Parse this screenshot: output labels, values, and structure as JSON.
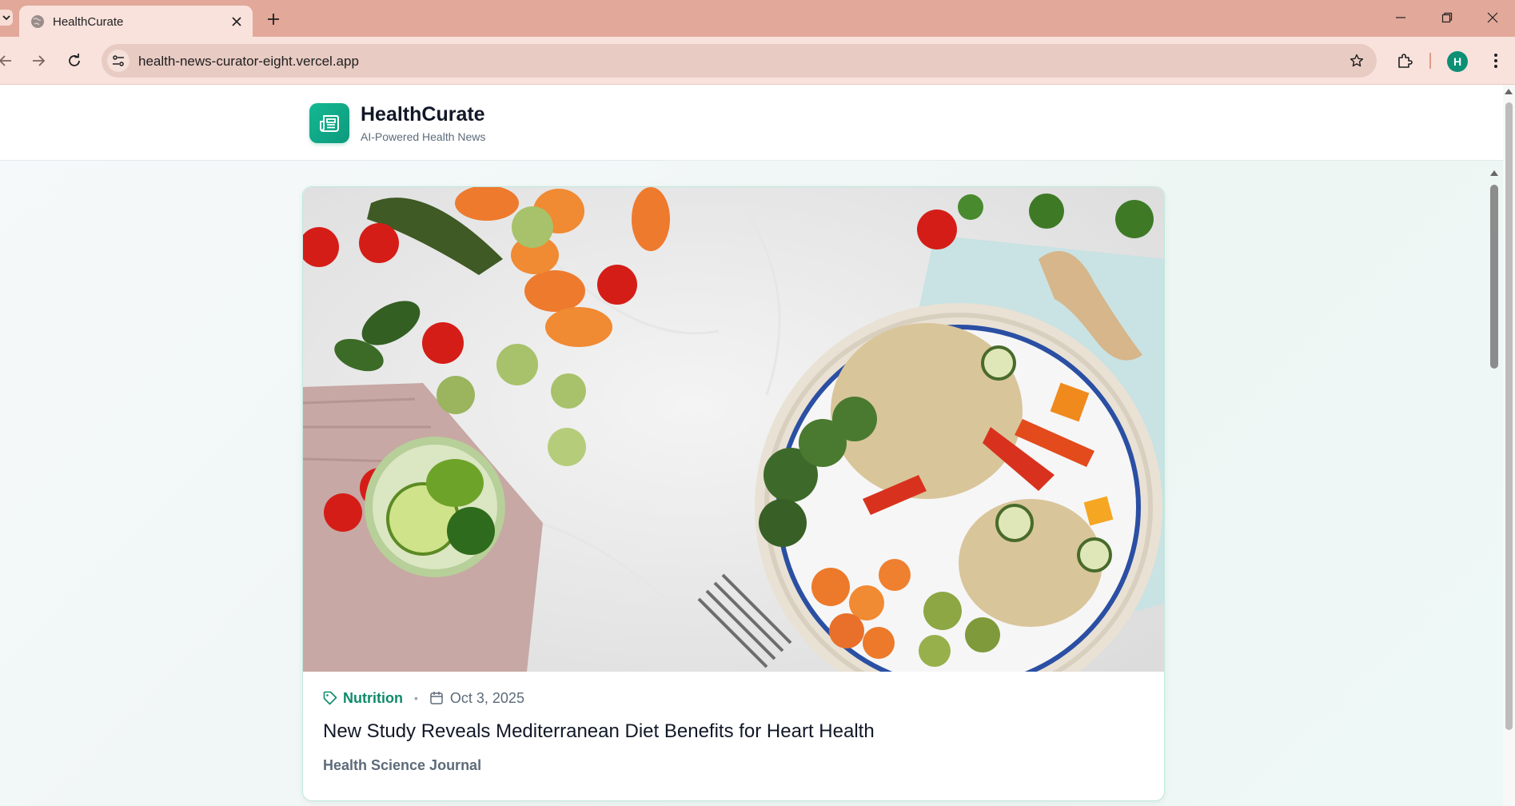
{
  "browser": {
    "tab_title": "HealthCurate",
    "url": "health-news-curator-eight.vercel.app",
    "profile_initial": "H",
    "accent": "#0b8f75"
  },
  "site": {
    "brand_name": "HealthCurate",
    "tagline": "AI-Powered Health News",
    "brand_color": "#10a884"
  },
  "featured_article": {
    "category": "Nutrition",
    "date": "Oct 3, 2025",
    "headline": "New Study Reveals Mediterranean Diet Benefits for Heart Health",
    "source": "Health Science Journal"
  }
}
